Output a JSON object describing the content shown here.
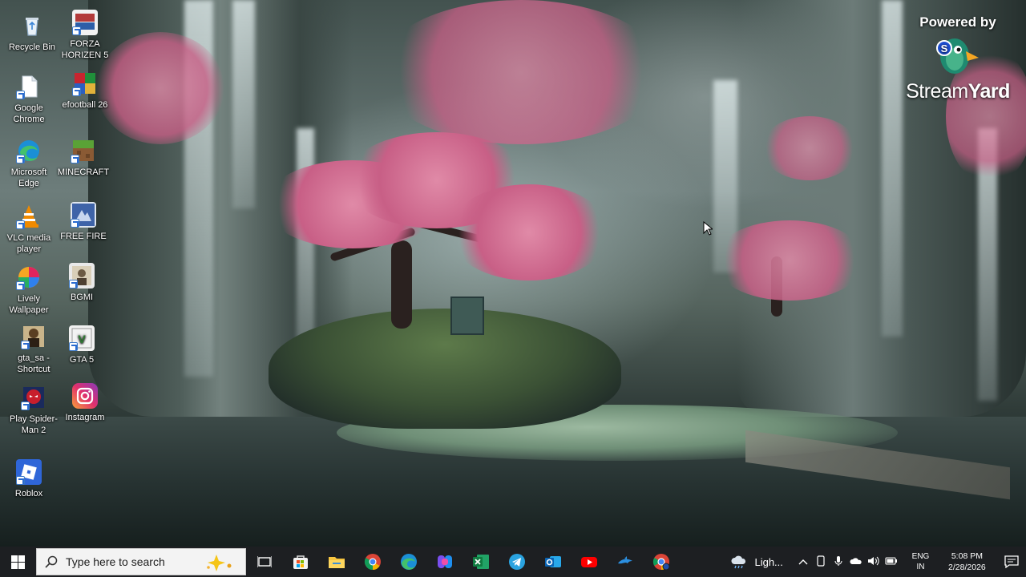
{
  "desktop": {
    "icons": [
      {
        "label": "Recycle Bin",
        "icon": "recycle-bin-icon"
      },
      {
        "label": "FORZA HORIZEN 5",
        "icon": "forza-horizon-icon"
      },
      {
        "label": "Google Chrome",
        "icon": "file-shortcut-icon"
      },
      {
        "label": "efootball 26",
        "icon": "efootball-icon"
      },
      {
        "label": "Microsoft Edge",
        "icon": "edge-icon"
      },
      {
        "label": "MINECRAFT",
        "icon": "minecraft-icon"
      },
      {
        "label": "VLC media player",
        "icon": "vlc-icon"
      },
      {
        "label": "FREE FIRE",
        "icon": "free-fire-icon"
      },
      {
        "label": "Lively Wallpaper",
        "icon": "lively-wallpaper-icon"
      },
      {
        "label": "BGMI",
        "icon": "bgmi-icon"
      },
      {
        "label": "gta_sa - Shortcut",
        "icon": "gta-sa-icon"
      },
      {
        "label": "GTA 5",
        "icon": "gta5-icon"
      },
      {
        "label": "Play Spider-Man 2",
        "icon": "spider-man-icon"
      },
      {
        "label": "Instagram",
        "icon": "instagram-icon"
      },
      {
        "label": "Roblox",
        "icon": "roblox-icon"
      }
    ]
  },
  "overlay": {
    "powered_by": "Powered by",
    "brand_light": "Stream",
    "brand_bold": "Yard"
  },
  "taskbar": {
    "search_placeholder": "Type here to search",
    "apps": [
      "task-view-icon",
      "microsoft-store-icon",
      "file-explorer-icon",
      "chrome-icon",
      "edge-icon",
      "copilot-icon",
      "excel-icon",
      "telegram-icon",
      "outlook-icon",
      "youtube-icon",
      "dolphin-icon",
      "chrome-profile-icon"
    ],
    "weather_text": "Ligh...",
    "language_line1": "ENG",
    "language_line2": "IN",
    "time": "5:08 PM",
    "date": "2/28/2026"
  },
  "colors": {
    "taskbar_bg": "#1d1f22",
    "search_bg": "#f3f3f3",
    "blossom": "#d9789c"
  }
}
